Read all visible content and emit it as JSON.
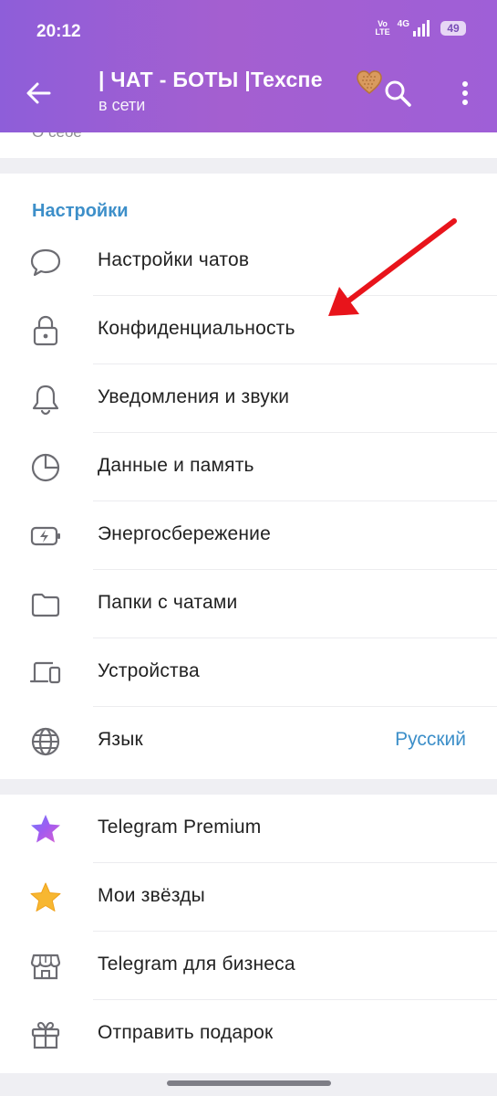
{
  "status_bar": {
    "time": "20:12",
    "volte_top": "Vo",
    "volte_bottom": "LTE",
    "network": "4G",
    "battery": "49"
  },
  "header": {
    "title": "| ЧАТ - БОТЫ |Техспе",
    "subtitle": "в сети"
  },
  "profile": {
    "about_label": "О себе"
  },
  "settings": {
    "section_title": "Настройки",
    "items": [
      {
        "label": "Настройки чатов",
        "icon": "chat-bubble-icon"
      },
      {
        "label": "Конфиденциальность",
        "icon": "lock-icon"
      },
      {
        "label": "Уведомления и звуки",
        "icon": "bell-icon"
      },
      {
        "label": "Данные и память",
        "icon": "pie-chart-icon"
      },
      {
        "label": "Энергосбережение",
        "icon": "battery-bolt-icon"
      },
      {
        "label": "Папки с чатами",
        "icon": "folder-icon"
      },
      {
        "label": "Устройства",
        "icon": "devices-icon"
      },
      {
        "label": "Язык",
        "value": "Русский",
        "icon": "globe-icon"
      }
    ]
  },
  "premium": {
    "items": [
      {
        "label": "Telegram Premium",
        "icon": "premium-star-icon"
      },
      {
        "label": "Мои звёзды",
        "icon": "gold-star-icon"
      },
      {
        "label": "Telegram для бизнеса",
        "icon": "shop-icon"
      },
      {
        "label": "Отправить подарок",
        "icon": "gift-icon"
      }
    ]
  },
  "colors": {
    "header_gradient_start": "#8e5ed9",
    "header_gradient_end": "#9f5fd7",
    "accent_blue": "#3d8fc9",
    "annotation_arrow": "#e8141b"
  }
}
